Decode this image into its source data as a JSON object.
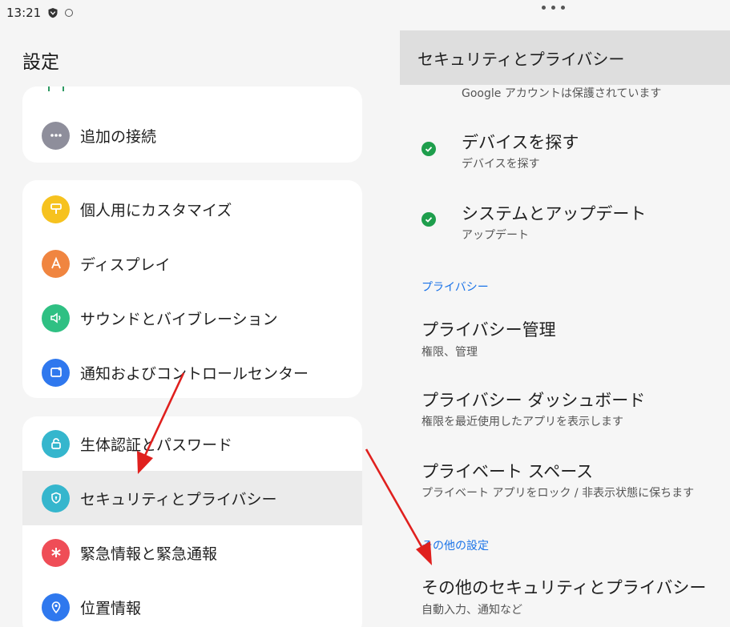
{
  "status_bar": {
    "time": "13:21"
  },
  "left": {
    "title": "設定",
    "card1": [
      {
        "label": "追加の接続",
        "icon": "more-dots-icon",
        "color": "#8e8e9b"
      }
    ],
    "card2": [
      {
        "label": "個人用にカスタマイズ",
        "icon": "paint-roller-icon",
        "color": "#f6c21f"
      },
      {
        "label": "ディスプレイ",
        "icon": "display-a-icon",
        "color": "#f08540"
      },
      {
        "label": "サウンドとバイブレーション",
        "icon": "speaker-icon",
        "color": "#2fc083"
      },
      {
        "label": "通知およびコントロールセンター",
        "icon": "notification-icon",
        "color": "#2f78ee"
      }
    ],
    "card3": [
      {
        "label": "生体認証とパスワード",
        "icon": "lock-icon",
        "color": "#35b6cd"
      },
      {
        "label": "セキュリティとプライバシー",
        "icon": "shield-icon",
        "color": "#35b6cd",
        "selected": true
      },
      {
        "label": "緊急情報と緊急通報",
        "icon": "asterisk-icon",
        "color": "#ef4d57"
      },
      {
        "label": "位置情報",
        "icon": "location-pin-icon",
        "color": "#2f78ee"
      }
    ]
  },
  "right": {
    "header": "セキュリティとプライバシー",
    "google_sub": "Google アカウントは保護されています",
    "find_device": {
      "title": "デバイスを探す",
      "sub": "デバイスを探す"
    },
    "system_update": {
      "title": "システムとアップデート",
      "sub": "アップデート"
    },
    "privacy_section": "プライバシー",
    "privacy_manage": {
      "title": "プライバシー管理",
      "sub": "権限、管理"
    },
    "privacy_dashboard": {
      "title": "プライバシー ダッシュボード",
      "sub": "権限を最近使用したアプリを表示します"
    },
    "private_space": {
      "title": "プライベート スペース",
      "sub": "プライベート アプリをロック / 非表示状態に保ちます"
    },
    "other_section": "その他の設定",
    "other_security": {
      "title": "その他のセキュリティとプライバシー",
      "sub": "自動入力、通知など"
    }
  },
  "colors": {
    "accent_blue": "#1a73e8",
    "check_green": "#1e9e4c",
    "arrow_red": "#e0201e"
  }
}
